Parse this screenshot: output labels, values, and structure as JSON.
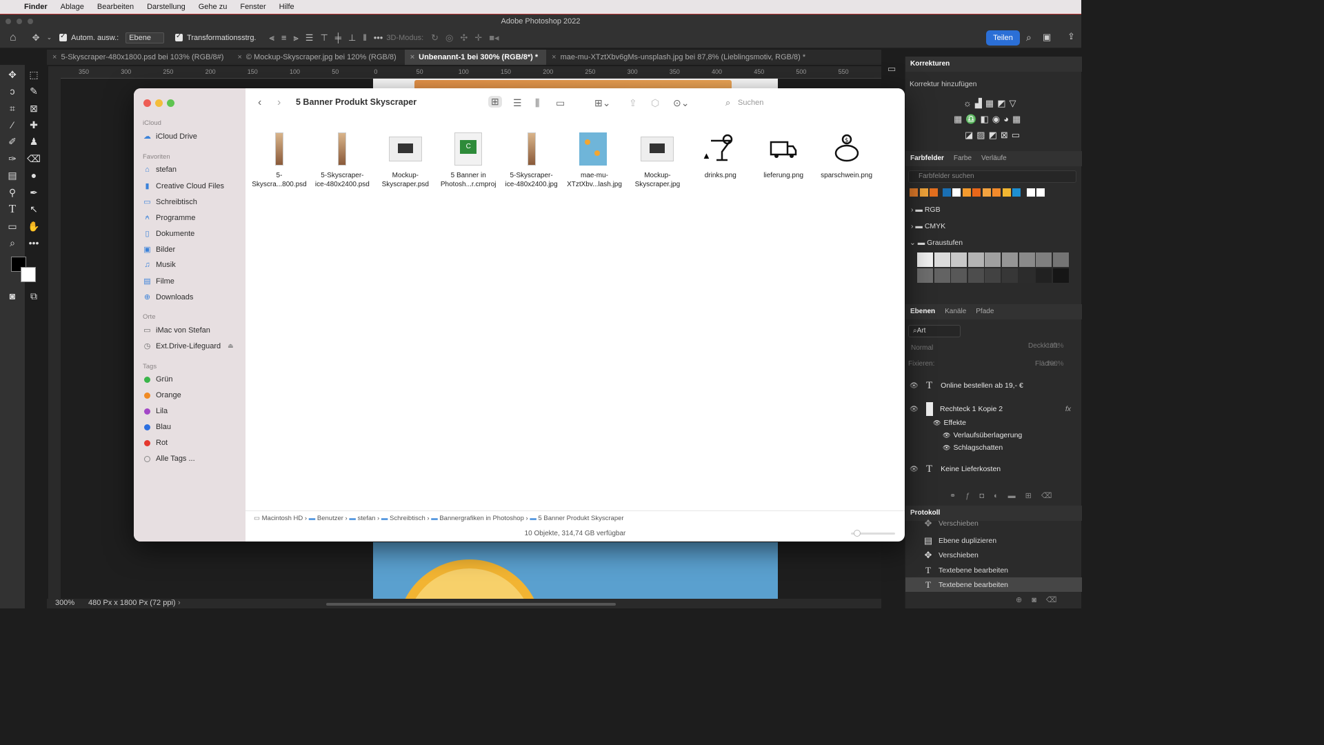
{
  "menubar": {
    "apple": "",
    "items": [
      "Finder",
      "Ablage",
      "Bearbeiten",
      "Darstellung",
      "Gehe zu",
      "Fenster",
      "Hilfe"
    ]
  },
  "app_title": "Adobe Photoshop 2022",
  "options": {
    "auto_select_label": "Autom. ausw.:",
    "auto_select_value": "Ebene",
    "transform_label": "Transformationsstrg.",
    "mode_3d": "3D-Modus:",
    "share_label": "Teilen"
  },
  "doc_tabs": [
    {
      "label": "5-Skyscraper-480x1800.psd bei 103% (RGB/8#)",
      "active": false
    },
    {
      "label": "© Mockup-Skyscraper.jpg bei 120% (RGB/8)",
      "active": false
    },
    {
      "label": "Unbenannt-1 bei 300% (RGB/8*) *",
      "active": true
    },
    {
      "label": "mae-mu-XTztXbv6gMs-unsplash.jpg bei 87,8% (Lieblingsmotiv, RGB/8) *",
      "active": false
    }
  ],
  "ruler_ticks": [
    "350",
    "300",
    "250",
    "200",
    "150",
    "100",
    "50",
    "0",
    "50",
    "100",
    "150",
    "200",
    "250",
    "300",
    "350",
    "400",
    "450",
    "500",
    "550"
  ],
  "status": {
    "zoom": "300%",
    "doc_info": "480 Px x 1800 Px (72 ppi)"
  },
  "corrections": {
    "tab": "Korrekturen",
    "subtitle": "Korrektur hinzufügen"
  },
  "swatches_panel": {
    "tabs": [
      "Farbfelder",
      "Farbe",
      "Verläufe"
    ],
    "search_placeholder": "Farbfelder suchen",
    "colors": [
      "#e07b2a",
      "#f0a33a",
      "#e36f1f",
      "#1a6fb3",
      "#ffffff",
      "#f39a2e",
      "#e8671a",
      "#f4a340",
      "#f28a2b",
      "#f2b632",
      "#1e8fd1",
      "#ffffff",
      "#ffffff"
    ],
    "groups": [
      "RGB",
      "CMYK",
      "Graustufen"
    ],
    "grays": [
      "#f0f0f0",
      "#dcdcdc",
      "#c8c8c8",
      "#b4b4b4",
      "#a0a0a0",
      "#959595",
      "#8a8a8a",
      "#7f7f7f",
      "#747474",
      "#6e6e6e",
      "#636363",
      "#585858",
      "#4d4d4d",
      "#424242",
      "#373737",
      "#2c2c2c",
      "#212121",
      "#161616"
    ]
  },
  "layers_panel": {
    "tabs": [
      "Ebenen",
      "Kanäle",
      "Pfade"
    ],
    "filter": "Art",
    "blend": "Normal",
    "opacity_label": "Deckkraft:",
    "opacity_value": "100%",
    "lock_label": "Fixieren:",
    "fill_label": "Fläche:",
    "fill_value": "100%",
    "layers": [
      {
        "name": "Online bestellen ab 19,- €",
        "type": "text"
      },
      {
        "name": "Rechteck 1 Kopie 2",
        "type": "shape"
      },
      {
        "name": "Effekte",
        "type": "effects"
      },
      {
        "name": "Verlaufsüberlagerung",
        "type": "effect"
      },
      {
        "name": "Schlagschatten",
        "type": "effect"
      },
      {
        "name": "Keine Lieferkosten",
        "type": "text"
      }
    ]
  },
  "history_panel": {
    "tab": "Protokoll",
    "items": [
      "Verschieben",
      "Ebene duplizieren",
      "Verschieben",
      "Textebene bearbeiten",
      "Textebene bearbeiten"
    ]
  },
  "finder": {
    "title": "5 Banner Produkt Skyscraper",
    "search_placeholder": "Suchen",
    "sidebar": {
      "icloud_header": "iCloud",
      "icloud_items": [
        "iCloud Drive"
      ],
      "favorites_header": "Favoriten",
      "favorites": [
        "stefan",
        "Creative Cloud Files",
        "Schreibtisch",
        "Programme",
        "Dokumente",
        "Bilder",
        "Musik",
        "Filme",
        "Downloads"
      ],
      "places_header": "Orte",
      "places": [
        "iMac von Stefan",
        "Ext.Drive-Lifeguard"
      ],
      "tags_header": "Tags",
      "tags": [
        {
          "name": "Grün",
          "color": "#3bb54a"
        },
        {
          "name": "Orange",
          "color": "#f08a24"
        },
        {
          "name": "Lila",
          "color": "#a347c7"
        },
        {
          "name": "Blau",
          "color": "#2d6fe0"
        },
        {
          "name": "Rot",
          "color": "#e5382e"
        },
        {
          "name": "Alle Tags ...",
          "color": ""
        }
      ]
    },
    "files": [
      {
        "line1": "5-",
        "line2": "Skyscra...800.psd",
        "icon": "skyscraper-thumb"
      },
      {
        "line1": "5-Skyscraper-",
        "line2": "ice-480x2400.psd",
        "icon": "skyscraper-thumb"
      },
      {
        "line1": "Mockup-",
        "line2": "Skyscraper.psd",
        "icon": "monitor-thumb"
      },
      {
        "line1": "5 Banner in",
        "line2": "Photosh...r.cmproj",
        "icon": "project-file-icon"
      },
      {
        "line1": "5-Skyscraper-",
        "line2": "ice-480x2400.jpg",
        "icon": "skyscraper-thumb"
      },
      {
        "line1": "mae-mu-",
        "line2": "XTztXbv...lash.jpg",
        "icon": "photo-thumb"
      },
      {
        "line1": "Mockup-",
        "line2": "Skyscraper.jpg",
        "icon": "monitor-thumb"
      },
      {
        "line1": "drinks.png",
        "line2": "",
        "icon": "drink-icon"
      },
      {
        "line1": "lieferung.png",
        "line2": "",
        "icon": "truck-icon"
      },
      {
        "line1": "sparschwein.png",
        "line2": "",
        "icon": "piggy-bank-icon"
      }
    ],
    "path": [
      "Macintosh HD",
      "Benutzer",
      "stefan",
      "Schreibtisch",
      "Bannergrafiken in Photoshop",
      "5 Banner Produkt Skyscraper"
    ],
    "status": "10 Objekte, 314,74 GB verfügbar"
  }
}
